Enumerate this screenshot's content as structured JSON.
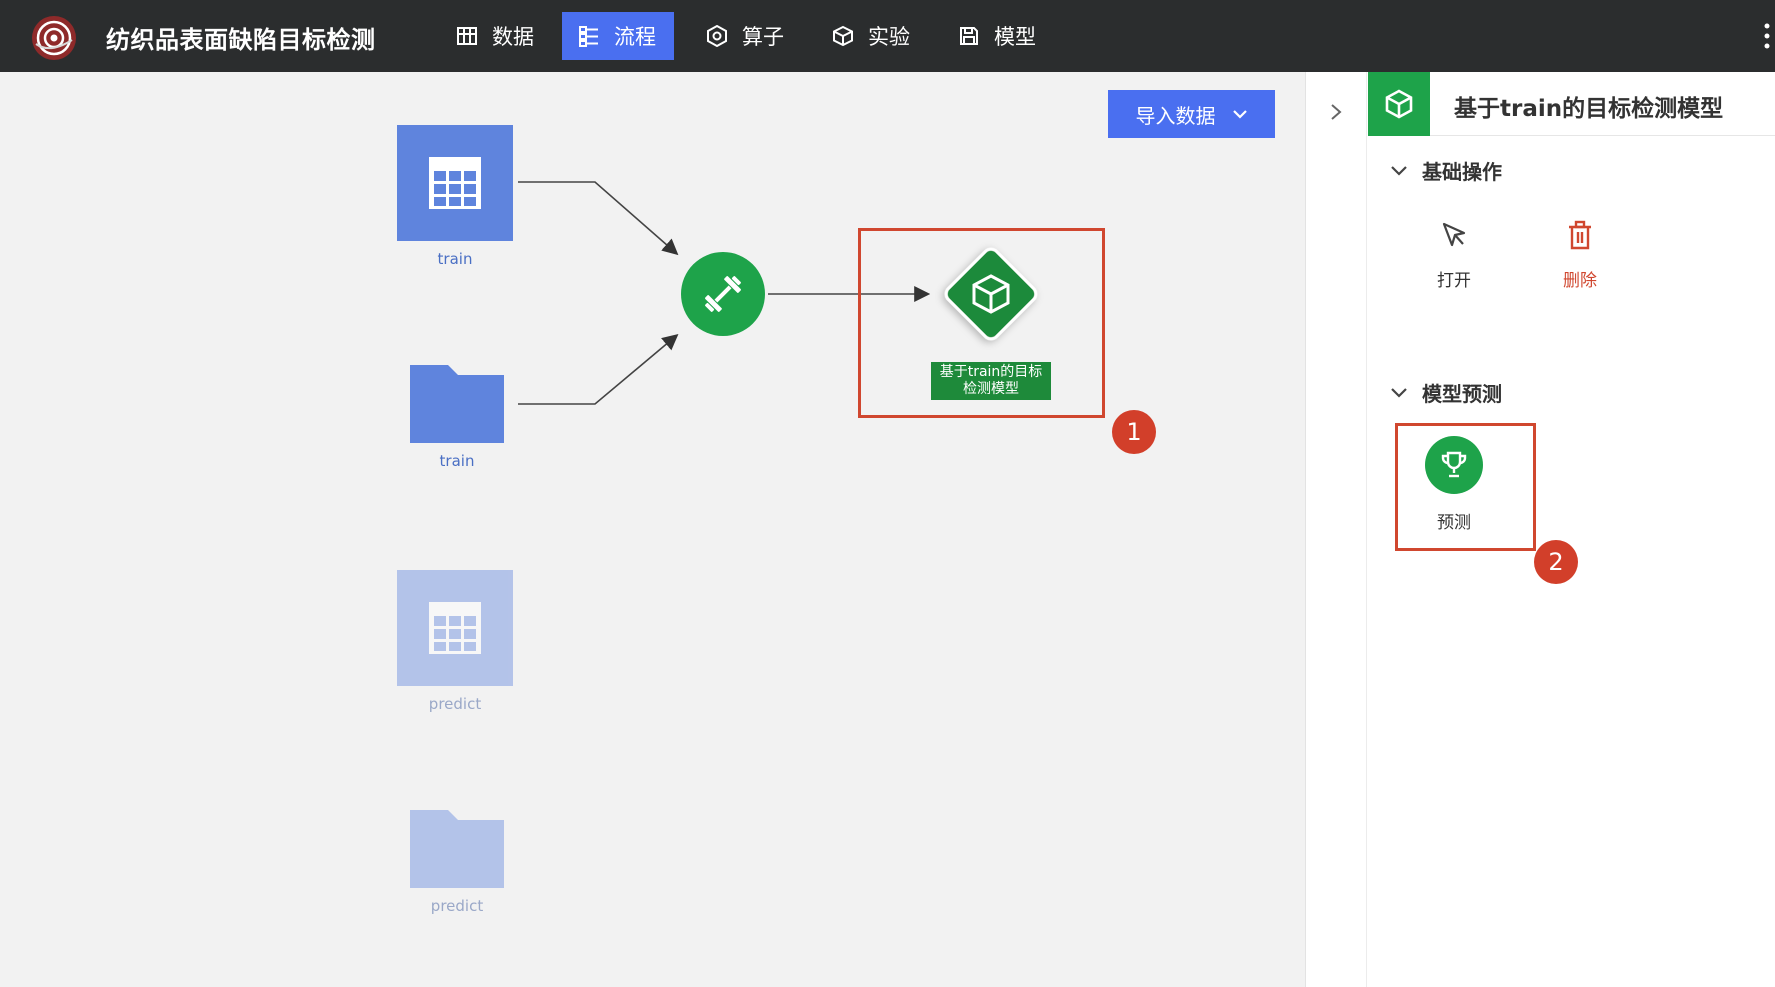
{
  "app": {
    "title": "纺织品表面缺陷目标检测"
  },
  "nav": {
    "items": [
      {
        "label": "数据",
        "icon": "table-icon",
        "active": false
      },
      {
        "label": "流程",
        "icon": "flow-icon",
        "active": true
      },
      {
        "label": "算子",
        "icon": "operator-icon",
        "active": false
      },
      {
        "label": "实验",
        "icon": "cube-icon",
        "active": false
      },
      {
        "label": "模型",
        "icon": "save-icon",
        "active": false
      }
    ]
  },
  "canvas": {
    "import_button": "导入数据",
    "nodes": {
      "train_table": "train",
      "train_folder": "train",
      "predict_table": "predict",
      "predict_folder": "predict",
      "model_label": "基于train的目标检测模型"
    },
    "badges": {
      "first": "1",
      "second": "2"
    }
  },
  "panel": {
    "title": "基于train的目标检测模型",
    "sections": {
      "basic": "基础操作",
      "predict": "模型预测"
    },
    "ops": {
      "open": "打开",
      "delete": "删除",
      "predict": "预测"
    }
  },
  "colors": {
    "topbar": "#2b2d2e",
    "accent": "#4a6ff0",
    "green": "#1ea34a",
    "node_blue": "#5f84dd",
    "highlight": "#d0472f"
  }
}
